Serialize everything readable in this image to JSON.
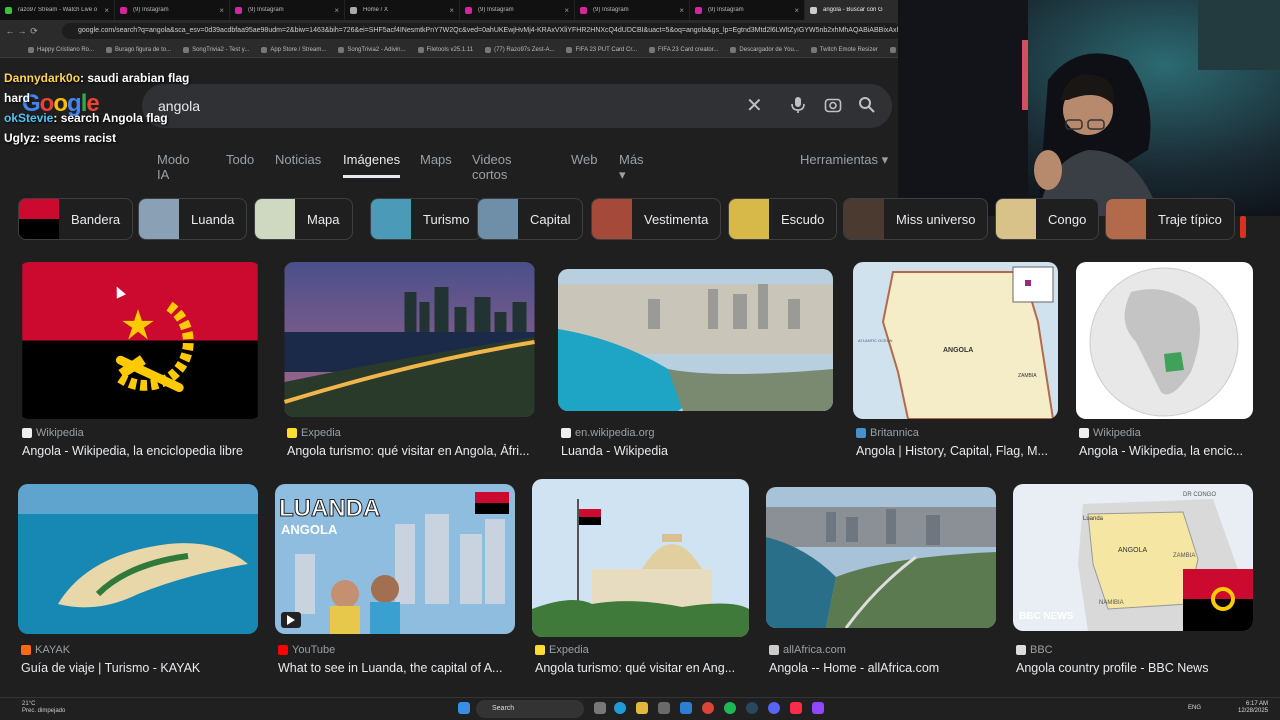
{
  "browser": {
    "tabs": [
      {
        "title": "razo97 Stream - Watch Live o",
        "color": "#3fbf3f",
        "active": false
      },
      {
        "title": "(9) Instagram",
        "color": "#d6249f",
        "active": false
      },
      {
        "title": "(9) Instagram",
        "color": "#d6249f",
        "active": false
      },
      {
        "title": "Home / X",
        "color": "#aaaaaa",
        "active": false
      },
      {
        "title": "(9) Instagram",
        "color": "#d6249f",
        "active": false
      },
      {
        "title": "(9) Instagram",
        "color": "#d6249f",
        "active": false
      },
      {
        "title": "(9) Instagram",
        "color": "#d6249f",
        "active": false
      },
      {
        "title": "angola - Buscar con G",
        "color": "#cccccc",
        "active": true
      }
    ],
    "url": "google.com/search?q=angola&sca_esv=0d39acdbfaa95ae98udm=2&biw=1463&bih=726&ei=SHF5acf4INesmtkPnY7W2Qc&ved=0ahUKEwjHvMj4-KRAxVXliYFHR2HNXcQ4dUDCBI&uact=5&oq=angola&gs_lp=Egtnd3Mtd2l6LWltZyIGYW5nb2xhMhAQABiABBixAxhD",
    "bookmarks": [
      "Happy Cristiano Ro...",
      "Burago figura de to...",
      "SongTrivia2 - Test y...",
      "App Store / Stream...",
      "SongTrivia2 - Adivin...",
      "Filetools v25.1.11",
      "(77) Razo97s Zest-A...",
      "FIFA 23 PUT Card Cr...",
      "FIFA 23 Card creator...",
      "Descargador de You...",
      "Twitch Emote Resizer",
      "twitch em"
    ]
  },
  "google": {
    "logo": "Google",
    "query": "angola",
    "nav_tabs": [
      "Modo IA",
      "Todo",
      "Noticias",
      "Imágenes",
      "Maps",
      "Videos cortos",
      "Web",
      "Más"
    ],
    "active_tab": "Imágenes",
    "tools": "Herramientas",
    "chips": [
      "Bandera",
      "Luanda",
      "Mapa",
      "Turismo",
      "Capital",
      "Vestimenta",
      "Escudo",
      "Miss universo",
      "Congo",
      "Traje típico"
    ],
    "results_row1": [
      {
        "source": "Wikipedia",
        "caption": "Angola - Wikipedia, la enciclopedia libre",
        "image": "flag-image"
      },
      {
        "source": "Expedia",
        "caption": "Angola turismo: qué visitar en Angola, Áfri...",
        "image": "city-night-image"
      },
      {
        "source": "en.wikipedia.org",
        "caption": "Luanda - Wikipedia",
        "image": "city-aerial-image"
      },
      {
        "source": "Britannica",
        "caption": "Angola | History, Capital, Flag, M...",
        "image": "map-image"
      },
      {
        "source": "Wikipedia",
        "caption": "Angola - Wikipedia, la encic...",
        "image": "globe-image"
      }
    ],
    "results_row2": [
      {
        "source": "KAYAK",
        "caption": "Guía de viaje | Turismo - KAYAK",
        "image": "island-image"
      },
      {
        "source": "YouTube",
        "caption": "What to see in Luanda, the capital of A...",
        "image": "video-thumb-image",
        "thumb_title": "LUANDA",
        "thumb_sub": "ANGOLA"
      },
      {
        "source": "Expedia",
        "caption": "Angola turismo: qué visitar en Ang...",
        "image": "palace-image"
      },
      {
        "source": "allAfrica.com",
        "caption": "Angola -- Home - allAfrica.com",
        "image": "city-coast-image"
      },
      {
        "source": "BBC",
        "caption": "Angola country profile - BBC News",
        "image": "bbc-map-image",
        "map_labels": [
          "DR CONGO",
          "Luanda",
          "ANGOLA",
          "ZAMBIA",
          "NAMIBIA"
        ],
        "badge": "BBC NEWS"
      }
    ],
    "map_labels_britannica": [
      "ANGOLA",
      "ATLANTIC OCEAN",
      "ZAMBIA"
    ]
  },
  "chat": [
    {
      "user": "Dannydark0o",
      "message": ": saudi arabian flag",
      "color": "#ffd54f"
    },
    {
      "user": "",
      "message": "hard",
      "color": "#ffffff"
    },
    {
      "user": "okStevie",
      "message": ": search Angola flag",
      "color": "#4fc3f7"
    },
    {
      "user": "Uglyz",
      "message": ": seems racist",
      "color": "#ffffff"
    }
  ],
  "taskbar": {
    "weather_temp": "21°C",
    "weather_desc": "Prec. dimpejado",
    "search": "Search",
    "lang": "ENG",
    "time": "6:17 AM",
    "date": "12/28/2025"
  },
  "colors": {
    "angola_red": "#cc092f",
    "angola_black": "#000000",
    "angola_yellow": "#ffcb00",
    "google_bg": "#1f1f1f"
  }
}
